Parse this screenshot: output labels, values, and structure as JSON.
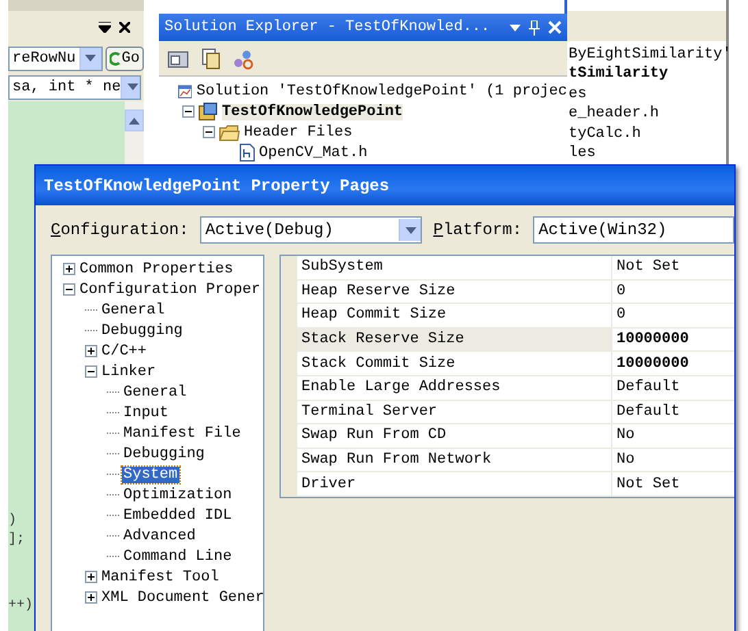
{
  "left_panel": {
    "member_combo": "reRowNu",
    "go_button": "Go",
    "signature_combo": "sa, int * ne",
    "code_lines": [
      ")",
      "];",
      "++)"
    ]
  },
  "solution_explorer": {
    "title": "Solution Explorer - TestOfKnowled...",
    "tree": [
      {
        "label": "Solution 'TestOfKnowledgePoint' (1 projec",
        "kind": "solution",
        "selected": false,
        "children": [
          {
            "label": "TestOfKnowledgePoint",
            "kind": "project",
            "selected": true,
            "expanded": true,
            "children": [
              {
                "label": "Header Files",
                "kind": "folder",
                "selected": false,
                "expanded": true,
                "children": [
                  {
                    "label": "OpenCV_Mat.h",
                    "kind": "header",
                    "selected": false
                  }
                ]
              }
            ]
          }
        ]
      }
    ]
  },
  "background_window": {
    "lines": [
      {
        "text": "ByEightSimilarity'",
        "bold": false
      },
      {
        "text": "tSimilarity",
        "bold": true
      },
      {
        "text": "es",
        "bold": false
      },
      {
        "text": "e_header.h",
        "bold": false
      },
      {
        "text": "tyCalc.h",
        "bold": false
      },
      {
        "text": "les",
        "bold": false
      }
    ]
  },
  "dialog": {
    "title": "TestOfKnowledgePoint Property Pages",
    "configuration": {
      "label": "Configuration:",
      "value": "Active(Debug)"
    },
    "platform": {
      "label": "Platform:",
      "value": "Active(Win32)"
    },
    "tree": [
      {
        "label": "Common Properties",
        "expanded": false,
        "selected": false
      },
      {
        "label": "Configuration Proper",
        "expanded": true,
        "selected": false,
        "children": [
          {
            "label": "General",
            "selected": false
          },
          {
            "label": "Debugging",
            "selected": false
          },
          {
            "label": "C/C++",
            "expanded": false,
            "selected": false
          },
          {
            "label": "Linker",
            "expanded": true,
            "selected": false,
            "children": [
              {
                "label": "General",
                "selected": false
              },
              {
                "label": "Input",
                "selected": false
              },
              {
                "label": "Manifest File",
                "selected": false
              },
              {
                "label": "Debugging",
                "selected": false
              },
              {
                "label": "System",
                "selected": true
              },
              {
                "label": "Optimization",
                "selected": false
              },
              {
                "label": "Embedded IDL",
                "selected": false
              },
              {
                "label": "Advanced",
                "selected": false
              },
              {
                "label": "Command Line",
                "selected": false
              }
            ]
          },
          {
            "label": "Manifest Tool",
            "expanded": false,
            "selected": false
          },
          {
            "label": "XML Document Gener",
            "expanded": false,
            "selected": false
          }
        ]
      }
    ],
    "properties": [
      {
        "name": "SubSystem",
        "value": "Not Set",
        "modified": false,
        "selected": false
      },
      {
        "name": "Heap Reserve Size",
        "value": "0",
        "modified": false,
        "selected": false
      },
      {
        "name": "Heap Commit Size",
        "value": "0",
        "modified": false,
        "selected": false
      },
      {
        "name": "Stack Reserve Size",
        "value": "10000000",
        "modified": true,
        "selected": true
      },
      {
        "name": "Stack Commit Size",
        "value": "10000000",
        "modified": true,
        "selected": false
      },
      {
        "name": "Enable Large Addresses",
        "value": "Default",
        "modified": false,
        "selected": false
      },
      {
        "name": "Terminal Server",
        "value": "Default",
        "modified": false,
        "selected": false
      },
      {
        "name": "Swap Run From CD",
        "value": "No",
        "modified": false,
        "selected": false
      },
      {
        "name": "Swap Run From Network",
        "value": "No",
        "modified": false,
        "selected": false
      },
      {
        "name": "Driver",
        "value": "Not Set",
        "modified": false,
        "selected": false
      }
    ]
  }
}
